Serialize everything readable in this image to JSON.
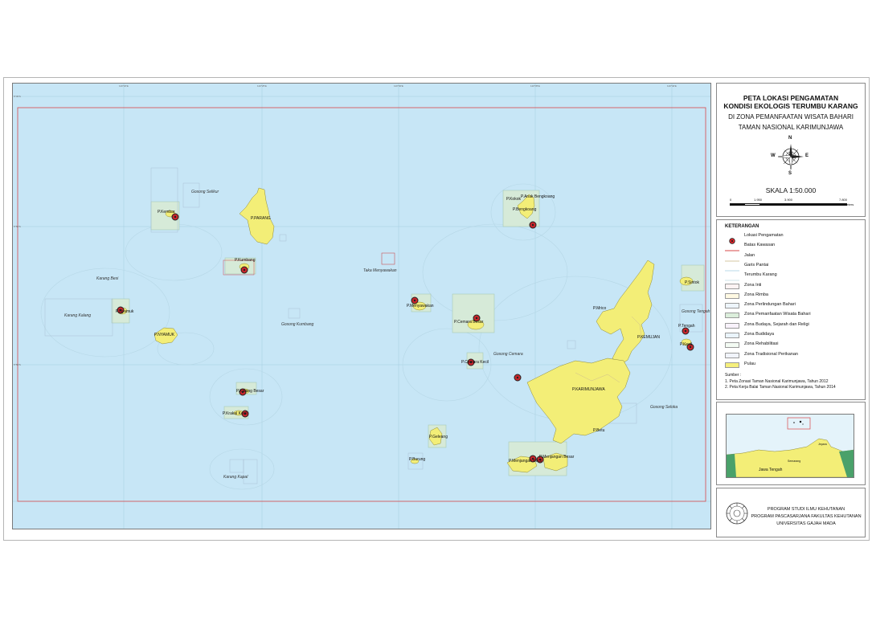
{
  "title": {
    "line1": "PETA LOKASI PENGAMATAN",
    "line2": "KONDISI EKOLOGIS TERUMBU KARANG",
    "line3": "DI ZONA PEMANFAATAN WISATA BAHARI",
    "line4": "TAMAN NASIONAL KARIMUNJAWA"
  },
  "compass": {
    "n": "N",
    "s": "S",
    "e": "E",
    "w": "W"
  },
  "scale": {
    "text": "SKALA   1:50.000",
    "ticks": [
      "0",
      "1.950",
      "3.900",
      "7.800"
    ],
    "unit": "Meters"
  },
  "legend": {
    "heading": "KETERANGAN",
    "items": [
      {
        "label": "Lokasi Pengamatan",
        "symbol": "point",
        "color": "#e3262b"
      },
      {
        "label": "Batas Kawasan",
        "symbol": "line",
        "color": "#d8484a"
      },
      {
        "label": "Jalan",
        "symbol": "line",
        "color": "#d6c7a0"
      },
      {
        "label": "Garis Pantai",
        "symbol": "line",
        "color": "#b9d8e8"
      },
      {
        "label": "Terumbu Karang",
        "symbol": "line",
        "color": "#cfe3ea"
      },
      {
        "label": "Zona Inti",
        "symbol": "fill",
        "color": "#fdf3f3"
      },
      {
        "label": "Zona Rimba",
        "symbol": "fill",
        "color": "#fff9e3"
      },
      {
        "label": "Zona Perlindungan Bahari",
        "symbol": "fill",
        "color": "#eef5fb"
      },
      {
        "label": "Zona Pemanfaatan Wisata Bahari",
        "symbol": "fill",
        "color": "#dbeedb"
      },
      {
        "label": "Zona Budaya, Sejarah dan Religi",
        "symbol": "fill",
        "color": "#f8f2fb"
      },
      {
        "label": "Zona Budidaya",
        "symbol": "fill",
        "color": "#eaf4fb"
      },
      {
        "label": "Zona Rehabilitasi",
        "symbol": "fill",
        "color": "#f3fbf3"
      },
      {
        "label": "Zona Tradisional Perikanan",
        "symbol": "fill",
        "color": "#f1f4fb"
      },
      {
        "label": "Pulau",
        "symbol": "fill",
        "color": "#f5ef7c"
      }
    ]
  },
  "sources": {
    "heading": "Sumber :",
    "items": [
      "1. Peta Zonasi Taman Nasional Karimunjawa, Tahun 2012",
      "2. Peta Kerja Balai Taman Nasional Karimunjawa, Tahun 2014"
    ]
  },
  "inset": {
    "labels": [
      "Jawa Tengah",
      "Semarang",
      "Jepara"
    ]
  },
  "footer": {
    "line1": "PROGRAM STUDI ILMU KEHUTANAN",
    "line2": "PROGRAM PASCASARJANA FAKULTAS KEHUTANAN",
    "line3": "UNIVERSITAS GAJAH MADA"
  },
  "map": {
    "island_labels": [
      "P.Kembar",
      "P.PARANG",
      "P.Kumbang",
      "P.Nyamuk",
      "P.Kecil",
      "P.NYAMUK",
      "P.Kokok",
      "P.Anak Bengkoang",
      "P.Bengkoang",
      "P.Menyawakan",
      "P.Cemara Besar",
      "P.Cemara Kecil",
      "P.Sintok",
      "P.Tengah",
      "P.Kecil",
      "P.KEMUJAN",
      "P.Mrico",
      "P.KARIMUNJAWA",
      "P.Betu",
      "P.Geleang",
      "P.Burung",
      "P.Menjangan Kecil",
      "P.Menjangan Besar",
      "P.Katang Besar",
      "P.Krakal Kecil"
    ],
    "water_labels": [
      "Gosong Selikur",
      "Karang Besi",
      "Karang Kalang",
      "Gosong Kumbang",
      "Taka Menyawakan",
      "Gosong Cemara",
      "Gosong Tengah",
      "Gosong Seloka",
      "Karang Kapal"
    ],
    "grid_ticks_x": [
      "110°20'E",
      "110°25'E",
      "110°30'E",
      "110°35'E",
      "110°40'E"
    ],
    "grid_ticks_y": [
      "5°45'S",
      "5°50'S",
      "5°55'S"
    ]
  }
}
